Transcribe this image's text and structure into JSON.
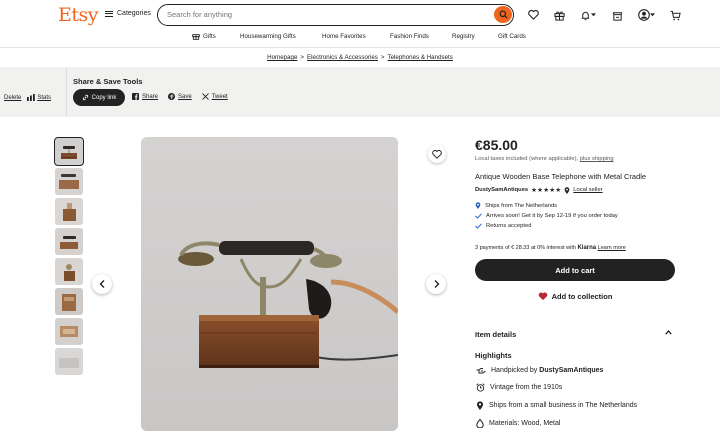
{
  "header": {
    "logo": "Etsy",
    "categories_label": "Categories",
    "search_placeholder": "Search for anything"
  },
  "subnav": {
    "items": [
      "Gifts",
      "Housewarming Gifts",
      "Home Favorites",
      "Fashion Finds",
      "Registry",
      "Gift Cards"
    ]
  },
  "breadcrumb": {
    "items": [
      "Homepage",
      "Electronics & Accessories",
      "Telephones & Handsets"
    ],
    "separator": ">"
  },
  "sharebar": {
    "delete_label": "Delete",
    "stats_label": "Stats",
    "title": "Share & Save Tools",
    "copy_link_label": "Copy link",
    "share_label": "Share",
    "save_label": "Save",
    "tweet_label": "Tweet"
  },
  "listing": {
    "price": "€85.00",
    "taxes_text": "Local taxes included (where applicable),",
    "shipping_link": "plus shipping",
    "title": "Antique Wooden Base Telephone with Metal Cradle",
    "shop_name": "DustySamAntiques",
    "stars": "★★★★★",
    "rating": 5,
    "local_seller": "Local seller",
    "features": [
      "Ships from The Netherlands",
      "Arrives soon! Get it by Sep 12-19 if you order today",
      "Returns accepted"
    ],
    "klarna_prefix": "3 payments of",
    "klarna_amount": "€ 28.33",
    "klarna_mid": "at 0% interest with",
    "klarna_brand": "Klarna",
    "klarna_link": "Learn more",
    "add_to_cart": "Add to cart",
    "add_to_collection": "Add to collection",
    "item_details": "Item details",
    "highlights_title": "Highlights",
    "highlights": {
      "handpicked_prefix": "Handpicked by",
      "handpicked_shop": "DustySamAntiques",
      "vintage": "Vintage from the 1910s",
      "ships": "Ships from a small business in The Netherlands",
      "materials": "Materials: Wood, Metal"
    }
  },
  "colors": {
    "brand": "#f1641e",
    "button_dark": "#222222",
    "heart_red": "#b7283a",
    "check_blue": "#2f66c6"
  }
}
